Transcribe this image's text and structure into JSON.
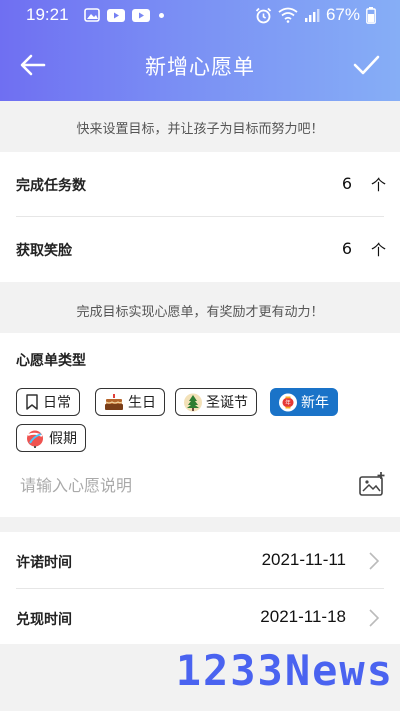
{
  "status_bar": {
    "time": "19:21",
    "battery": "67%"
  },
  "header": {
    "title": "新增心愿单"
  },
  "hints": {
    "top": "快来设置目标，并让孩子为目标而努力吧！",
    "middle": "完成目标实现心愿单，有奖励才更有动力！"
  },
  "goals": {
    "tasks": {
      "label": "完成任务数",
      "value": "6",
      "unit": "个"
    },
    "smiles": {
      "label": "获取笑脸",
      "value": "6",
      "unit": "个"
    }
  },
  "wish_type": {
    "title": "心愿单类型",
    "options": [
      {
        "label": "日常",
        "icon": "bookmark-icon",
        "selected": false
      },
      {
        "label": "生日",
        "icon": "cake-icon",
        "selected": false
      },
      {
        "label": "圣诞节",
        "icon": "christmas-tree-icon",
        "selected": false
      },
      {
        "label": "新年",
        "icon": "lantern-icon",
        "selected": true
      },
      {
        "label": "假期",
        "icon": "beach-ball-icon",
        "selected": false
      }
    ],
    "description_placeholder": "请输入心愿说明"
  },
  "dates": {
    "promise": {
      "label": "许诺时间",
      "value": "2021-11-11"
    },
    "redeem": {
      "label": "兑现时间",
      "value": "2021-11-18"
    }
  },
  "watermark": "1233News",
  "colors": {
    "accent": "#1a73c8",
    "header_start": "#6f6ff2",
    "header_end": "#86aef6",
    "watermark": "#4a63f0"
  }
}
